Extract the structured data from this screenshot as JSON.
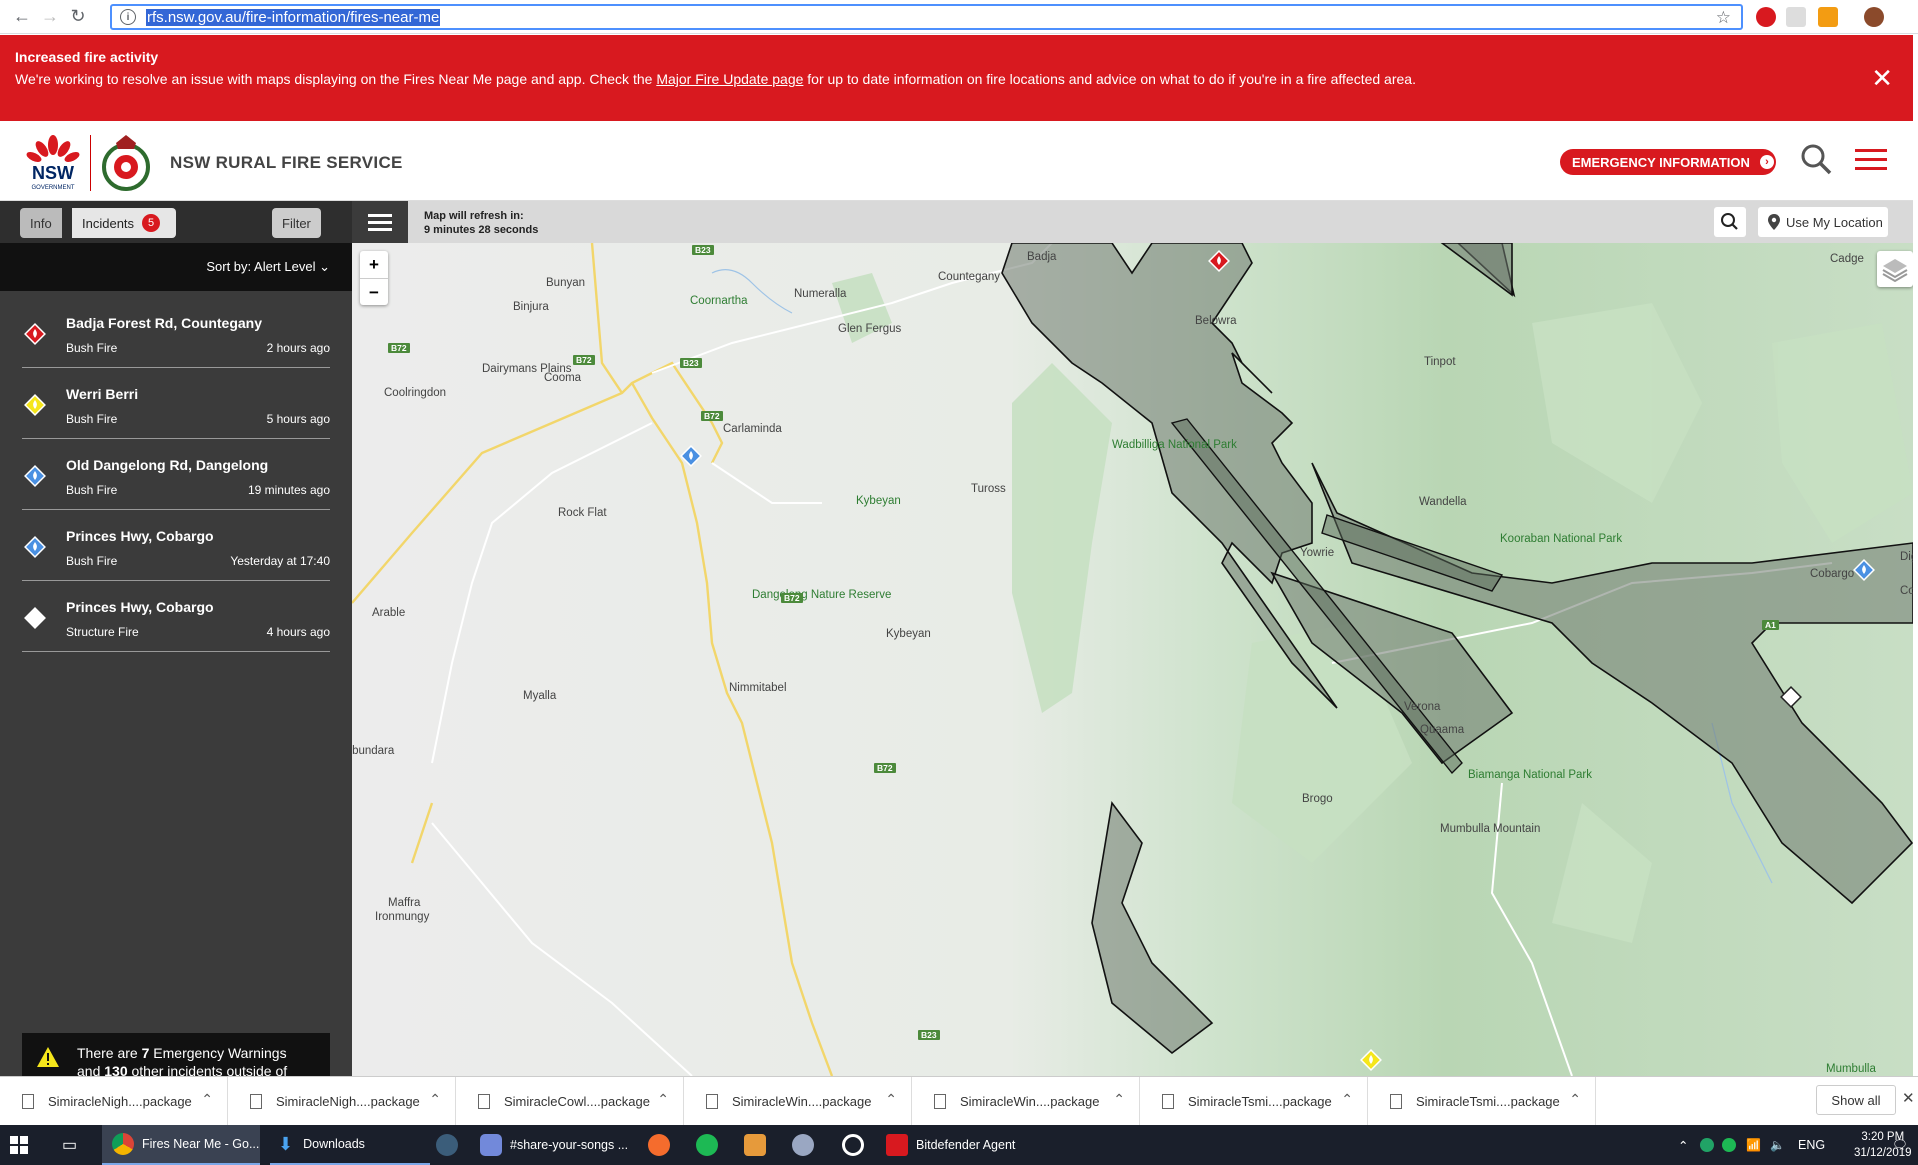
{
  "browser": {
    "url": "rfs.nsw.gov.au/fire-information/fires-near-me"
  },
  "banner": {
    "title": "Increased fire activity",
    "text_before": "We're working to resolve an issue with maps displaying on the Fires Near Me page and app. Check the ",
    "link": "Major Fire Update page",
    "text_after": " for up to date information on fire locations and advice on what to do if you're in a fire affected area.",
    "close": "✕"
  },
  "header": {
    "nsw_logo_text": "NSW",
    "nsw_logo_sub": "GOVERNMENT",
    "brand": "NSW RURAL FIRE SERVICE",
    "emergency_button": "EMERGENCY INFORMATION",
    "accent_color": "#d8191f"
  },
  "sidebar": {
    "tab_info": "Info",
    "tab_incidents": "Incidents",
    "incidents_count": "5",
    "filter": "Filter",
    "sort_label": "Sort by: Alert Level",
    "incidents": [
      {
        "name": "Badja Forest Rd, Countegany",
        "type": "Bush Fire",
        "time": "2 hours ago",
        "level": "emergency",
        "color": "#d8191f"
      },
      {
        "name": "Werri Berri",
        "type": "Bush Fire",
        "time": "5 hours ago",
        "level": "watch-and-act",
        "color": "#f5e61b"
      },
      {
        "name": "Old Dangelong Rd, Dangelong",
        "type": "Bush Fire",
        "time": "19 minutes ago",
        "level": "advice",
        "color": "#4a90e2"
      },
      {
        "name": "Princes Hwy, Cobargo",
        "type": "Bush Fire",
        "time": "Yesterday at 17:40",
        "level": "advice",
        "color": "#4a90e2"
      },
      {
        "name": "Princes Hwy, Cobargo",
        "type": "Structure Fire",
        "time": "4 hours ago",
        "level": "not-applicable",
        "color": "#ffffff"
      }
    ],
    "warning": {
      "pre": "There are ",
      "count_em": "7",
      "mid": " Emergency Warnings",
      "line2_pre": "and ",
      "count_other": "130",
      "line2_post": " other incidents outside of"
    }
  },
  "mapbar": {
    "refresh_label": "Map will refresh in:",
    "refresh_value": "9 minutes 28 seconds",
    "use_location": "Use My Location"
  },
  "map": {
    "zoom_in": "+",
    "zoom_out": "−",
    "places": [
      "Badja",
      "Countegany",
      "Cadge",
      "Belowra",
      "Tinpot",
      "Bunyan",
      "Binjura",
      "Coornartha",
      "Numeralla",
      "Glen Fergus",
      "Dairymans Plains",
      "Cooma",
      "Coolringdon",
      "Carlaminda",
      "Wadbilliga National Park",
      "Tuross",
      "Kybeyan",
      "Wandella",
      "Rock Flat",
      "Yowrie",
      "Kooraban National Park",
      "Cobargo",
      "Arable",
      "Dangelong Nature Reserve",
      "Kybeyan",
      "Nimmitabel",
      "Myalla",
      "Verona",
      "Quaama",
      "Bobundara",
      "Brogo",
      "Biamanga National Park",
      "Mumbulla Mountain",
      "Maffra",
      "Ironmungy",
      "Mumbulla",
      "Dign",
      "Coola"
    ],
    "shields": [
      "B23",
      "B72",
      "B23",
      "B72",
      "B72",
      "B72",
      "B72",
      "B23",
      "A1",
      "A1"
    ]
  },
  "downloads": {
    "items": [
      "SimiracleNigh....package",
      "SimiracleNigh....package",
      "SimiracleCowl....package",
      "SimiracleWin....package",
      "SimiracleWin....package",
      "SimiracleTsmi....package",
      "SimiracleTsmi....package"
    ],
    "show_all": "Show all"
  },
  "taskbar": {
    "chrome_title": "Fires Near Me - Go...",
    "downloads_title": "Downloads",
    "discord_title": "#share-your-songs ...",
    "bitdefender_title": "Bitdefender Agent",
    "lang": "ENG",
    "time": "3:20 PM",
    "date": "31/12/2019"
  }
}
